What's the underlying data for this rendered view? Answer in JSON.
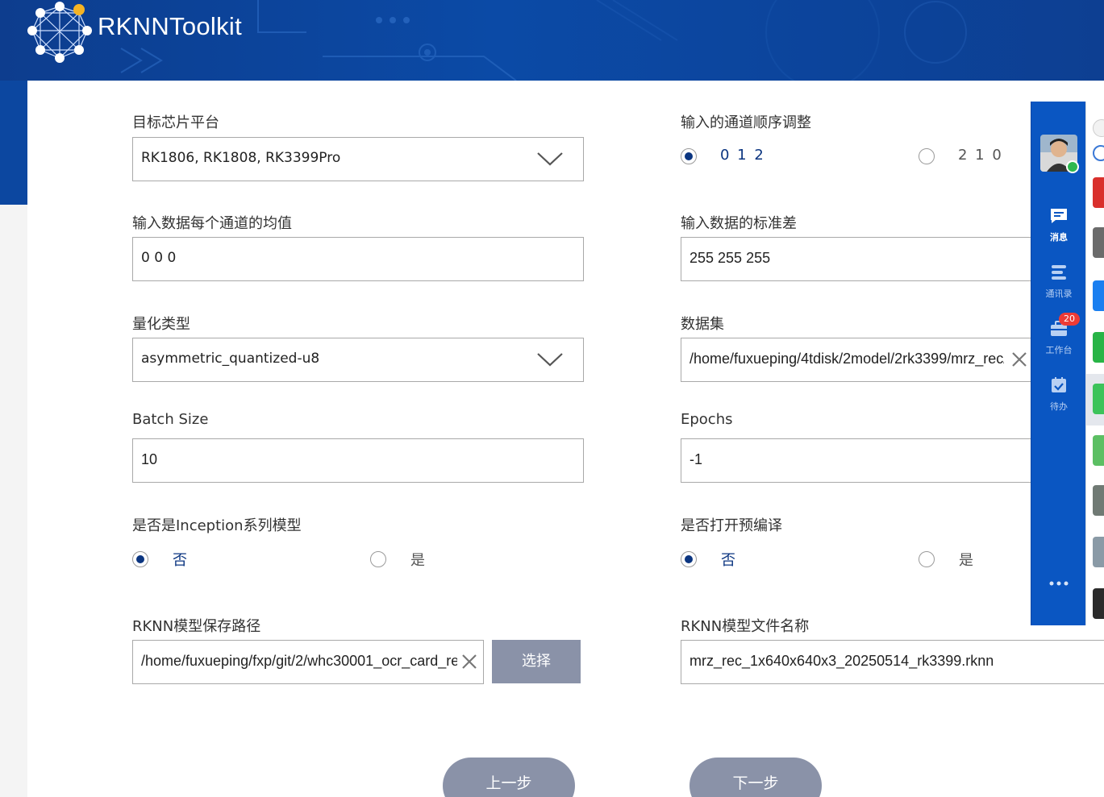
{
  "app": {
    "title": "RKNNToolkit"
  },
  "form": {
    "target_platform": {
      "label": "目标芯片平台",
      "value": "RK1806, RK1808, RK3399Pro"
    },
    "channel_order": {
      "label": "输入的通道顺序调整",
      "options": [
        "0 1 2",
        "2 1 0"
      ],
      "selected": "0 1 2"
    },
    "channel_mean": {
      "label": "输入数据每个通道的均值",
      "value": "0 0 0"
    },
    "std": {
      "label": "输入数据的标准差",
      "value": "255 255 255"
    },
    "quant_type": {
      "label": "量化类型",
      "value": "asymmetric_quantized-u8"
    },
    "dataset": {
      "label": "数据集",
      "value": "/home/fuxueping/4tdisk/2model/2rk3399/mrz_rec/"
    },
    "batch_size": {
      "label": "Batch Size",
      "value": "10"
    },
    "epochs": {
      "label": "Epochs",
      "value": "-1"
    },
    "inception": {
      "label": "是否是Inception系列模型",
      "options": [
        "否",
        "是"
      ],
      "selected": "否"
    },
    "precompile": {
      "label": "是否打开预编译",
      "options": [
        "否",
        "是"
      ],
      "selected": "否"
    },
    "save_path": {
      "label": "RKNN模型保存路径",
      "value": "/home/fuxueping/fxp/git/2/whc30001_ocr_card_re",
      "select_label": "选择"
    },
    "model_name": {
      "label": "RKNN模型文件名称",
      "value": "mrz_rec_1x640x640x3_20250514_rk3399.rknn"
    }
  },
  "nav": {
    "prev_label": "上一步",
    "next_label": "下一步"
  },
  "im_sidebar": {
    "items": [
      {
        "label": "消息",
        "icon": "message-icon",
        "active": true
      },
      {
        "label": "通讯录",
        "icon": "contacts-icon"
      },
      {
        "label": "工作台",
        "icon": "workbench-icon",
        "badge": "20"
      },
      {
        "label": "待办",
        "icon": "todo-icon"
      }
    ]
  },
  "colors": {
    "header": "#0b4aa6",
    "accent": "#0b3580",
    "button": "#8a92a8",
    "sidebar": "#0a56c2"
  }
}
